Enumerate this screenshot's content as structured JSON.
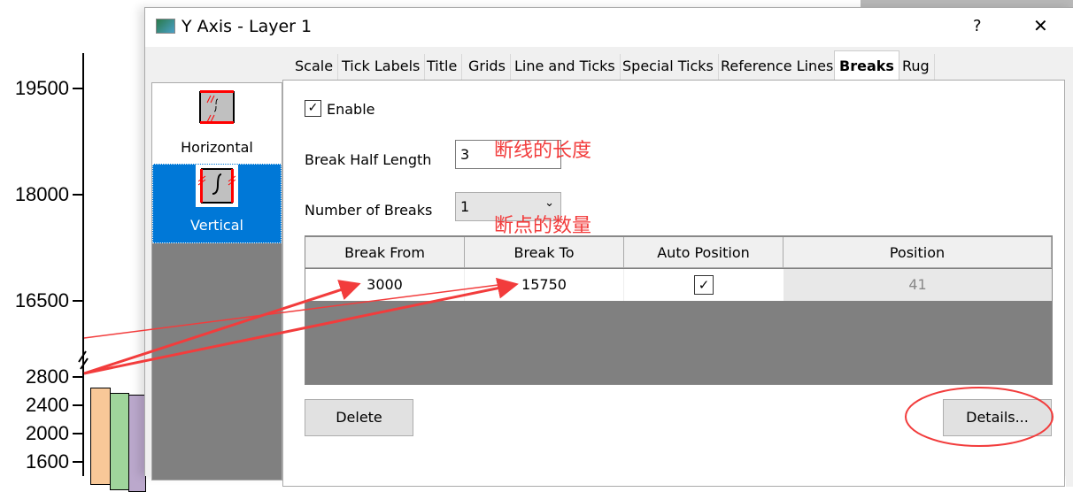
{
  "chart": {
    "ticks_upper": [
      "19500",
      "18000",
      "16500"
    ],
    "ticks_lower": [
      "2800",
      "2400",
      "2000",
      "1600"
    ],
    "bar_colors": [
      "#f8c898",
      "#9fd59b",
      "#bba8cc"
    ]
  },
  "dialog": {
    "title": "Y Axis - Layer 1",
    "help": "?",
    "close": "✕"
  },
  "tabs": [
    "Scale",
    "Tick Labels",
    "Title",
    "Grids",
    "Line and Ticks",
    "Special Ticks",
    "Reference Lines",
    "Breaks",
    "Rug"
  ],
  "active_tab": "Breaks",
  "side": {
    "items": [
      {
        "label": "Horizontal"
      },
      {
        "label": "Vertical"
      }
    ],
    "selected": "Vertical"
  },
  "breaks": {
    "enable_label": "Enable",
    "enable_checked": true,
    "half_length_label": "Break Half Length",
    "half_length_value": "3",
    "num_label": "Number of Breaks",
    "num_value": "1",
    "columns": [
      "Break From",
      "Break To",
      "Auto Position",
      "Position"
    ],
    "rows": [
      {
        "from": "3000",
        "to": "15750",
        "auto": true,
        "position": "41"
      }
    ],
    "delete": "Delete",
    "details": "Details..."
  },
  "annotations": {
    "half_length_note": "断线的长度",
    "num_note": "断点的数量",
    "color": "#f23c3c"
  }
}
